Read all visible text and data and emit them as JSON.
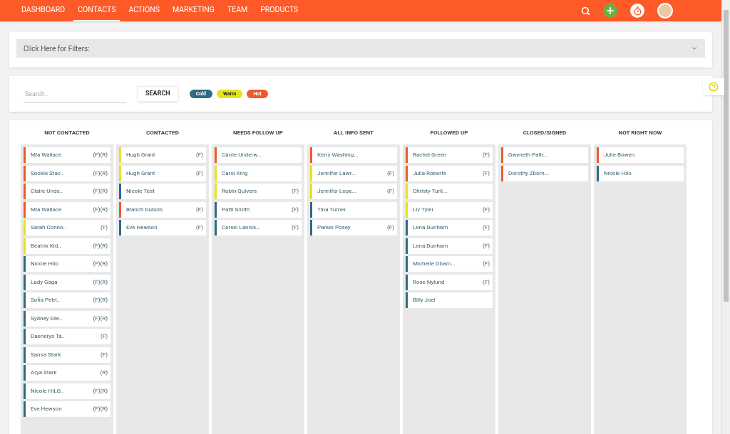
{
  "nav": {
    "items": [
      {
        "label": "DASHBOARD",
        "selected": false
      },
      {
        "label": "CONTACTS",
        "selected": true
      },
      {
        "label": "ACTIONS",
        "selected": false
      },
      {
        "label": "MARKETING",
        "selected": false
      },
      {
        "label": "TEAM",
        "selected": false
      },
      {
        "label": "PRODUCTS",
        "selected": false
      }
    ]
  },
  "filters": {
    "label": "Click Here for Filters:"
  },
  "search": {
    "placeholder": "Search..",
    "button": "SEARCH"
  },
  "legend": [
    {
      "label": "Cold",
      "color": "#2d6a86"
    },
    {
      "label": "Warm",
      "color": "#e4e41c"
    },
    {
      "label": "Hot",
      "color": "#f05a28"
    }
  ],
  "columns": [
    {
      "title": "NOT CONTACTED",
      "cards": [
        {
          "name": "Mia Wallace",
          "tags": "(F)(R)",
          "color": "#f05a28"
        },
        {
          "name": "Sookie Stac..",
          "tags": "(F)(R)",
          "color": "#f05a28"
        },
        {
          "name": "Claire Unde..",
          "tags": "(F)(R)",
          "color": "#f05a28"
        },
        {
          "name": "Mia Wallace",
          "tags": "(F)(R)",
          "color": "#f05a28"
        },
        {
          "name": "Sarah Conno..",
          "tags": "(F)",
          "color": "#e4e41c"
        },
        {
          "name": "Beatrix Kid..",
          "tags": "(F)(R)",
          "color": "#e4e41c"
        },
        {
          "name": "Nicole Hilo",
          "tags": "(F)(R)",
          "color": "#2d6a86"
        },
        {
          "name": "Lady Gaga",
          "tags": "(F)(R)",
          "color": "#2d6a86"
        },
        {
          "name": "Sofia Petri..",
          "tags": "(F)(R)",
          "color": "#2d6a86"
        },
        {
          "name": "Sydney Elle..",
          "tags": "(F)(R)",
          "color": "#2d6a86"
        },
        {
          "name": "Daenerys Ta..",
          "tags": "(F)",
          "color": "#2d6a86"
        },
        {
          "name": "Sansa Stark",
          "tags": "(F)",
          "color": "#2d6a86"
        },
        {
          "name": "Arya Stark",
          "tags": "(R)",
          "color": "#2d6a86"
        },
        {
          "name": "Nicole HILO..",
          "tags": "(F)(R)",
          "color": "#2d6a86"
        },
        {
          "name": "Eve Hewson",
          "tags": "(F)(R)",
          "color": "#2d6a86"
        }
      ]
    },
    {
      "title": "CONTACTED",
      "cards": [
        {
          "name": "Hugh Grant",
          "tags": "(F)",
          "color": "#e4e41c"
        },
        {
          "name": "Hugh Grant",
          "tags": "(F)",
          "color": "#e4e41c"
        },
        {
          "name": "Nicole Test",
          "color": "#2d6a86"
        },
        {
          "name": "Blanch Dubois",
          "tags": "(F)",
          "color": "#f05a28"
        },
        {
          "name": "Eve Hewson",
          "tags": "(F)",
          "color": "#2d6a86"
        }
      ]
    },
    {
      "title": "NEEDS FOLLOW UP",
      "cards": [
        {
          "name": "Carrie Underw...",
          "color": "#f05a28"
        },
        {
          "name": "Carol King",
          "color": "#e4e41c"
        },
        {
          "name": "Robin Quivers",
          "tags": "(F)",
          "color": "#e4e41c"
        },
        {
          "name": "Patti Smith",
          "tags": "(F)",
          "color": "#2d6a86"
        },
        {
          "name": "Cersei Lannis...",
          "tags": "(F)",
          "color": "#2d6a86"
        }
      ]
    },
    {
      "title": "ALL INFO SENT",
      "cards": [
        {
          "name": "Kerry Washing...",
          "color": "#f05a28"
        },
        {
          "name": "Jennifer Lawr...",
          "tags": "(F)",
          "color": "#e4e41c"
        },
        {
          "name": "Jennifer Lope...",
          "tags": "(F)",
          "color": "#e4e41c"
        },
        {
          "name": "Tina Turner",
          "color": "#2d6a86"
        },
        {
          "name": "Parker Posey",
          "tags": "(F)",
          "color": "#2d6a86"
        }
      ]
    },
    {
      "title": "FOLLOWED UP",
      "cards": [
        {
          "name": "Rachel Green",
          "tags": "(F)",
          "color": "#f05a28"
        },
        {
          "name": "Julia Roberts",
          "tags": "(F)",
          "color": "#f05a28"
        },
        {
          "name": "Christy Turli...",
          "color": "#e4e41c"
        },
        {
          "name": "Liv Tyler",
          "tags": "(F)",
          "color": "#e4e41c"
        },
        {
          "name": "Lena Dunham",
          "tags": "(F)",
          "color": "#2d6a86"
        },
        {
          "name": "Lena Dunham",
          "tags": "(F)",
          "color": "#2d6a86"
        },
        {
          "name": "Michelle Obam...",
          "tags": "(F)",
          "color": "#2d6a86"
        },
        {
          "name": "Rose Nylund",
          "tags": "(F)",
          "color": "#2d6a86"
        },
        {
          "name": "Billy Joel",
          "color": "#2d6a86"
        }
      ]
    },
    {
      "title": "CLOSED/SIGNED",
      "cards": [
        {
          "name": "Gwyneth Paltr...",
          "color": "#f05a28"
        },
        {
          "name": "Dorothy Zborn...",
          "color": "#f05a28"
        }
      ]
    },
    {
      "title": "NOT RIGHT NOW",
      "cards": [
        {
          "name": "Julie Bowen",
          "color": "#f05a28"
        },
        {
          "name": "Nicole Hilo",
          "color": "#2d6a86"
        }
      ]
    }
  ]
}
